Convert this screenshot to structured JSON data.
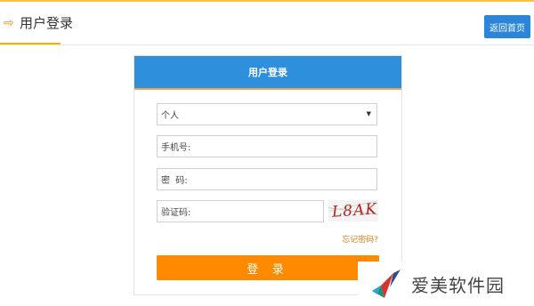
{
  "header": {
    "title": "用户登录",
    "back_label": "返回首页"
  },
  "login": {
    "title": "用户登录",
    "user_type": {
      "selected": "个人"
    },
    "phone_placeholder": "手机号:",
    "password_placeholder": "密  码:",
    "captcha_placeholder": "验证码:",
    "captcha_code": "L8AK",
    "forgot_label": "忘记密码?",
    "submit_label": "登 录"
  },
  "watermark": {
    "text": "爱美软件园"
  },
  "colors": {
    "accent_blue": "#2e8fdc",
    "accent_orange": "#ff8a00",
    "top_line": "#f5c542"
  }
}
